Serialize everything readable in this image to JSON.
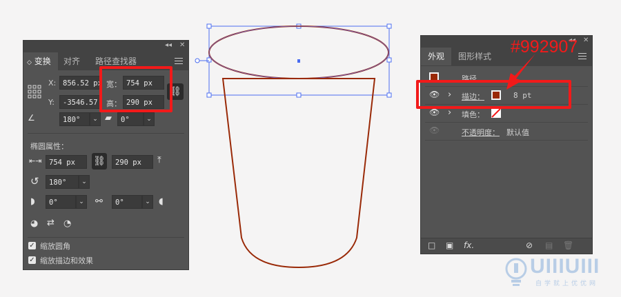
{
  "transform_panel": {
    "window_controls": {
      "collapse": "◂◂",
      "close": "✕"
    },
    "tabs": [
      {
        "label": "变换",
        "prefix": "◇"
      },
      {
        "label": "对齐"
      },
      {
        "label": "路径查找器"
      }
    ],
    "x_label": "X:",
    "x_value": "856.52 px",
    "y_label": "Y:",
    "y_value": "-3546.57",
    "width_label": "宽：",
    "width_value": "754 px",
    "height_label": "高：",
    "height_value": "290 px",
    "rotate_value": "180°",
    "shear_value": "0°",
    "ellipse_section_title": "椭圆属性：",
    "ellipse_width": "754 px",
    "ellipse_height": "290 px",
    "ellipse_rotate": "180°",
    "pie_start": "0°",
    "pie_end": "0°",
    "scale_corners_label": "缩放圆角",
    "scale_strokes_label": "缩放描边和效果"
  },
  "appearance_panel": {
    "window_controls": {
      "collapse": "◂◂",
      "close": "✕"
    },
    "tabs": [
      {
        "label": "外观"
      },
      {
        "label": "图形样式"
      }
    ],
    "path_label": "路径",
    "stroke_label": "描边：",
    "stroke_weight": "8 pt",
    "fill_label": "填色：",
    "opacity_label": "不透明度：",
    "opacity_value": "默认值",
    "footer_fx": "fx."
  },
  "annotation_color_text": "#992907",
  "colors": {
    "stroke": "#992907",
    "highlight": "#f21a1a",
    "panel_bg": "#535353",
    "selection": "#4a6cf0"
  },
  "watermark": {
    "word": "UIIIUIII",
    "tagline": "自学就上优优网"
  }
}
